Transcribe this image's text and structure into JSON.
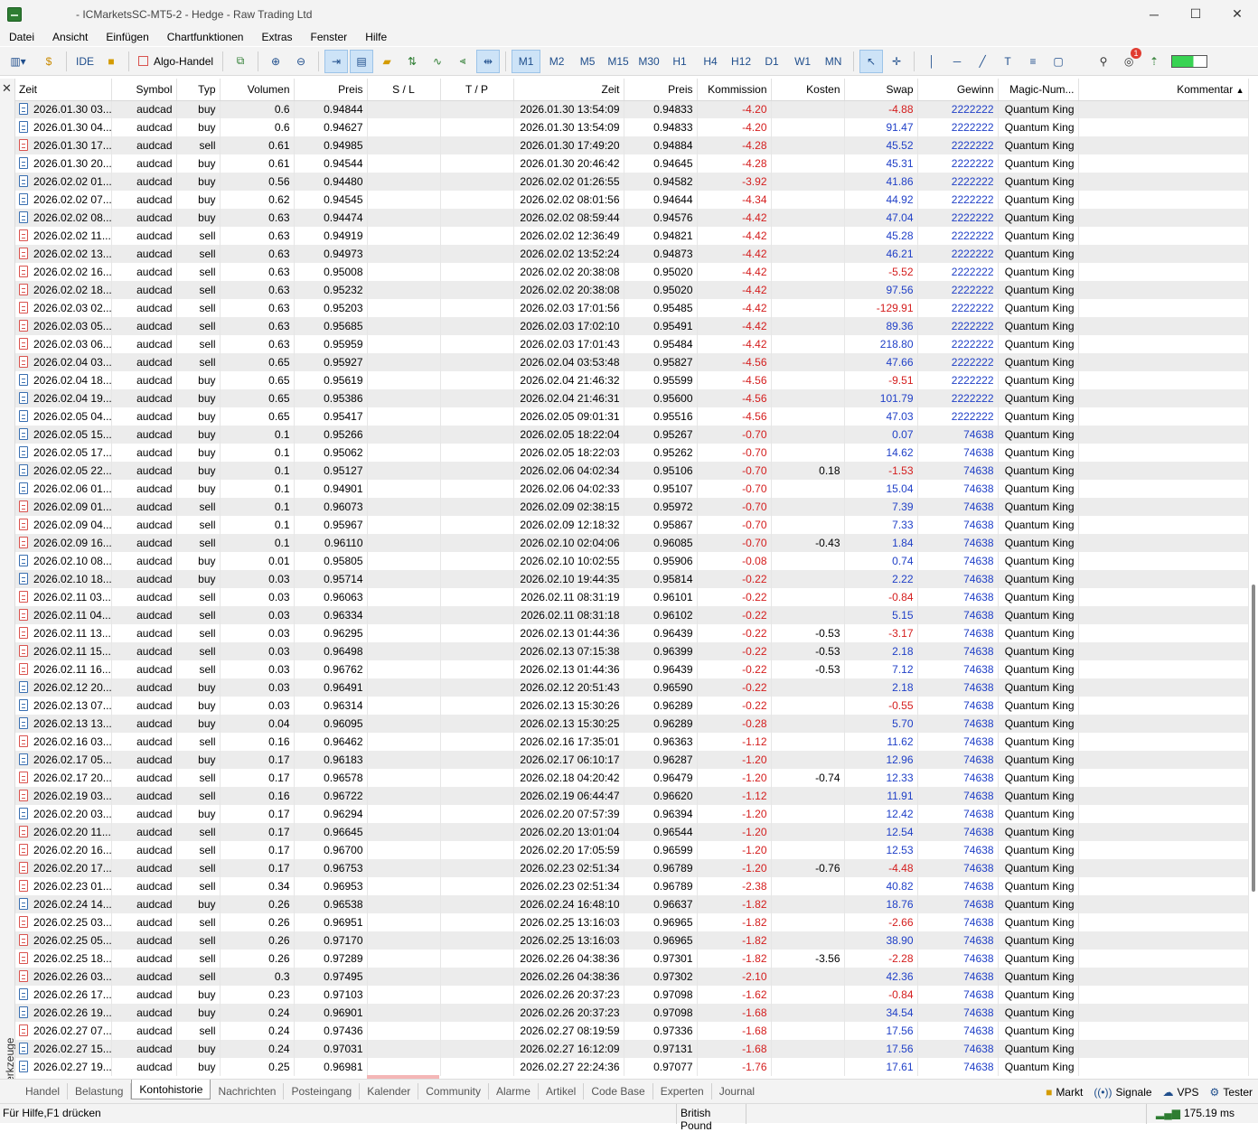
{
  "window": {
    "title": "- ICMarketsSC-MT5-2 - Hedge - Raw Trading Ltd"
  },
  "menu": [
    "Datei",
    "Ansicht",
    "Einfügen",
    "Chartfunktionen",
    "Extras",
    "Fenster",
    "Hilfe"
  ],
  "toolbar": {
    "ide_label": "IDE",
    "algo_label": "Algo-Handel",
    "timeframes": [
      "M1",
      "M2",
      "M5",
      "M15",
      "M30",
      "H1",
      "H4",
      "H12",
      "D1",
      "W1",
      "MN"
    ],
    "active_timeframe": "M1",
    "notification_count": "1"
  },
  "table": {
    "headers": [
      "Zeit",
      "Symbol",
      "Typ",
      "Volumen",
      "Preis",
      "S / L",
      "T / P",
      "Zeit",
      "Preis",
      "Kommission",
      "Kosten",
      "Swap",
      "Gewinn",
      "Magic-Num...",
      "Kommentar"
    ],
    "rows": [
      [
        "2026.01.30 03...",
        "audcad",
        "buy",
        "0.6",
        "0.94844",
        "2026.01.30 13:54:09",
        "0.94833",
        "-4.20",
        "",
        "-4.88",
        "2222222",
        "Quantum King"
      ],
      [
        "2026.01.30 04...",
        "audcad",
        "buy",
        "0.6",
        "0.94627",
        "2026.01.30 13:54:09",
        "0.94833",
        "-4.20",
        "",
        "91.47",
        "2222222",
        "Quantum King"
      ],
      [
        "2026.01.30 17...",
        "audcad",
        "sell",
        "0.61",
        "0.94985",
        "2026.01.30 17:49:20",
        "0.94884",
        "-4.28",
        "",
        "45.52",
        "2222222",
        "Quantum King"
      ],
      [
        "2026.01.30 20...",
        "audcad",
        "buy",
        "0.61",
        "0.94544",
        "2026.01.30 20:46:42",
        "0.94645",
        "-4.28",
        "",
        "45.31",
        "2222222",
        "Quantum King"
      ],
      [
        "2026.02.02 01...",
        "audcad",
        "buy",
        "0.56",
        "0.94480",
        "2026.02.02 01:26:55",
        "0.94582",
        "-3.92",
        "",
        "41.86",
        "2222222",
        "Quantum King"
      ],
      [
        "2026.02.02 07...",
        "audcad",
        "buy",
        "0.62",
        "0.94545",
        "2026.02.02 08:01:56",
        "0.94644",
        "-4.34",
        "",
        "44.92",
        "2222222",
        "Quantum King"
      ],
      [
        "2026.02.02 08...",
        "audcad",
        "buy",
        "0.63",
        "0.94474",
        "2026.02.02 08:59:44",
        "0.94576",
        "-4.42",
        "",
        "47.04",
        "2222222",
        "Quantum King"
      ],
      [
        "2026.02.02 11...",
        "audcad",
        "sell",
        "0.63",
        "0.94919",
        "2026.02.02 12:36:49",
        "0.94821",
        "-4.42",
        "",
        "45.28",
        "2222222",
        "Quantum King"
      ],
      [
        "2026.02.02 13...",
        "audcad",
        "sell",
        "0.63",
        "0.94973",
        "2026.02.02 13:52:24",
        "0.94873",
        "-4.42",
        "",
        "46.21",
        "2222222",
        "Quantum King"
      ],
      [
        "2026.02.02 16...",
        "audcad",
        "sell",
        "0.63",
        "0.95008",
        "2026.02.02 20:38:08",
        "0.95020",
        "-4.42",
        "",
        "-5.52",
        "2222222",
        "Quantum King"
      ],
      [
        "2026.02.02 18...",
        "audcad",
        "sell",
        "0.63",
        "0.95232",
        "2026.02.02 20:38:08",
        "0.95020",
        "-4.42",
        "",
        "97.56",
        "2222222",
        "Quantum King"
      ],
      [
        "2026.02.03 02...",
        "audcad",
        "sell",
        "0.63",
        "0.95203",
        "2026.02.03 17:01:56",
        "0.95485",
        "-4.42",
        "",
        "-129.91",
        "2222222",
        "Quantum King"
      ],
      [
        "2026.02.03 05...",
        "audcad",
        "sell",
        "0.63",
        "0.95685",
        "2026.02.03 17:02:10",
        "0.95491",
        "-4.42",
        "",
        "89.36",
        "2222222",
        "Quantum King"
      ],
      [
        "2026.02.03 06...",
        "audcad",
        "sell",
        "0.63",
        "0.95959",
        "2026.02.03 17:01:43",
        "0.95484",
        "-4.42",
        "",
        "218.80",
        "2222222",
        "Quantum King"
      ],
      [
        "2026.02.04 03...",
        "audcad",
        "sell",
        "0.65",
        "0.95927",
        "2026.02.04 03:53:48",
        "0.95827",
        "-4.56",
        "",
        "47.66",
        "2222222",
        "Quantum King"
      ],
      [
        "2026.02.04 18...",
        "audcad",
        "buy",
        "0.65",
        "0.95619",
        "2026.02.04 21:46:32",
        "0.95599",
        "-4.56",
        "",
        "-9.51",
        "2222222",
        "Quantum King"
      ],
      [
        "2026.02.04 19...",
        "audcad",
        "buy",
        "0.65",
        "0.95386",
        "2026.02.04 21:46:31",
        "0.95600",
        "-4.56",
        "",
        "101.79",
        "2222222",
        "Quantum King"
      ],
      [
        "2026.02.05 04...",
        "audcad",
        "buy",
        "0.65",
        "0.95417",
        "2026.02.05 09:01:31",
        "0.95516",
        "-4.56",
        "",
        "47.03",
        "2222222",
        "Quantum King"
      ],
      [
        "2026.02.05 15...",
        "audcad",
        "buy",
        "0.1",
        "0.95266",
        "2026.02.05 18:22:04",
        "0.95267",
        "-0.70",
        "",
        "0.07",
        "74638",
        "Quantum King"
      ],
      [
        "2026.02.05 17...",
        "audcad",
        "buy",
        "0.1",
        "0.95062",
        "2026.02.05 18:22:03",
        "0.95262",
        "-0.70",
        "",
        "14.62",
        "74638",
        "Quantum King"
      ],
      [
        "2026.02.05 22...",
        "audcad",
        "buy",
        "0.1",
        "0.95127",
        "2026.02.06 04:02:34",
        "0.95106",
        "-0.70",
        "0.18",
        "-1.53",
        "74638",
        "Quantum King"
      ],
      [
        "2026.02.06 01...",
        "audcad",
        "buy",
        "0.1",
        "0.94901",
        "2026.02.06 04:02:33",
        "0.95107",
        "-0.70",
        "",
        "15.04",
        "74638",
        "Quantum King"
      ],
      [
        "2026.02.09 01...",
        "audcad",
        "sell",
        "0.1",
        "0.96073",
        "2026.02.09 02:38:15",
        "0.95972",
        "-0.70",
        "",
        "7.39",
        "74638",
        "Quantum King"
      ],
      [
        "2026.02.09 04...",
        "audcad",
        "sell",
        "0.1",
        "0.95967",
        "2026.02.09 12:18:32",
        "0.95867",
        "-0.70",
        "",
        "7.33",
        "74638",
        "Quantum King"
      ],
      [
        "2026.02.09 16...",
        "audcad",
        "sell",
        "0.1",
        "0.96110",
        "2026.02.10 02:04:06",
        "0.96085",
        "-0.70",
        "-0.43",
        "1.84",
        "74638",
        "Quantum King"
      ],
      [
        "2026.02.10 08...",
        "audcad",
        "buy",
        "0.01",
        "0.95805",
        "2026.02.10 10:02:55",
        "0.95906",
        "-0.08",
        "",
        "0.74",
        "74638",
        "Quantum King"
      ],
      [
        "2026.02.10 18...",
        "audcad",
        "buy",
        "0.03",
        "0.95714",
        "2026.02.10 19:44:35",
        "0.95814",
        "-0.22",
        "",
        "2.22",
        "74638",
        "Quantum King"
      ],
      [
        "2026.02.11 03...",
        "audcad",
        "sell",
        "0.03",
        "0.96063",
        "2026.02.11 08:31:19",
        "0.96101",
        "-0.22",
        "",
        "-0.84",
        "74638",
        "Quantum King"
      ],
      [
        "2026.02.11 04...",
        "audcad",
        "sell",
        "0.03",
        "0.96334",
        "2026.02.11 08:31:18",
        "0.96102",
        "-0.22",
        "",
        "5.15",
        "74638",
        "Quantum King"
      ],
      [
        "2026.02.11 13...",
        "audcad",
        "sell",
        "0.03",
        "0.96295",
        "2026.02.13 01:44:36",
        "0.96439",
        "-0.22",
        "-0.53",
        "-3.17",
        "74638",
        "Quantum King"
      ],
      [
        "2026.02.11 15...",
        "audcad",
        "sell",
        "0.03",
        "0.96498",
        "2026.02.13 07:15:38",
        "0.96399",
        "-0.22",
        "-0.53",
        "2.18",
        "74638",
        "Quantum King"
      ],
      [
        "2026.02.11 16...",
        "audcad",
        "sell",
        "0.03",
        "0.96762",
        "2026.02.13 01:44:36",
        "0.96439",
        "-0.22",
        "-0.53",
        "7.12",
        "74638",
        "Quantum King"
      ],
      [
        "2026.02.12 20...",
        "audcad",
        "buy",
        "0.03",
        "0.96491",
        "2026.02.12 20:51:43",
        "0.96590",
        "-0.22",
        "",
        "2.18",
        "74638",
        "Quantum King"
      ],
      [
        "2026.02.13 07...",
        "audcad",
        "buy",
        "0.03",
        "0.96314",
        "2026.02.13 15:30:26",
        "0.96289",
        "-0.22",
        "",
        "-0.55",
        "74638",
        "Quantum King"
      ],
      [
        "2026.02.13 13...",
        "audcad",
        "buy",
        "0.04",
        "0.96095",
        "2026.02.13 15:30:25",
        "0.96289",
        "-0.28",
        "",
        "5.70",
        "74638",
        "Quantum King"
      ],
      [
        "2026.02.16 03...",
        "audcad",
        "sell",
        "0.16",
        "0.96462",
        "2026.02.16 17:35:01",
        "0.96363",
        "-1.12",
        "",
        "11.62",
        "74638",
        "Quantum King"
      ],
      [
        "2026.02.17 05...",
        "audcad",
        "buy",
        "0.17",
        "0.96183",
        "2026.02.17 06:10:17",
        "0.96287",
        "-1.20",
        "",
        "12.96",
        "74638",
        "Quantum King"
      ],
      [
        "2026.02.17 20...",
        "audcad",
        "sell",
        "0.17",
        "0.96578",
        "2026.02.18 04:20:42",
        "0.96479",
        "-1.20",
        "-0.74",
        "12.33",
        "74638",
        "Quantum King"
      ],
      [
        "2026.02.19 03...",
        "audcad",
        "sell",
        "0.16",
        "0.96722",
        "2026.02.19 06:44:47",
        "0.96620",
        "-1.12",
        "",
        "11.91",
        "74638",
        "Quantum King"
      ],
      [
        "2026.02.20 03...",
        "audcad",
        "buy",
        "0.17",
        "0.96294",
        "2026.02.20 07:57:39",
        "0.96394",
        "-1.20",
        "",
        "12.42",
        "74638",
        "Quantum King"
      ],
      [
        "2026.02.20 11...",
        "audcad",
        "sell",
        "0.17",
        "0.96645",
        "2026.02.20 13:01:04",
        "0.96544",
        "-1.20",
        "",
        "12.54",
        "74638",
        "Quantum King"
      ],
      [
        "2026.02.20 16...",
        "audcad",
        "sell",
        "0.17",
        "0.96700",
        "2026.02.20 17:05:59",
        "0.96599",
        "-1.20",
        "",
        "12.53",
        "74638",
        "Quantum King"
      ],
      [
        "2026.02.20 17...",
        "audcad",
        "sell",
        "0.17",
        "0.96753",
        "2026.02.23 02:51:34",
        "0.96789",
        "-1.20",
        "-0.76",
        "-4.48",
        "74638",
        "Quantum King"
      ],
      [
        "2026.02.23 01...",
        "audcad",
        "sell",
        "0.34",
        "0.96953",
        "2026.02.23 02:51:34",
        "0.96789",
        "-2.38",
        "",
        "40.82",
        "74638",
        "Quantum King"
      ],
      [
        "2026.02.24 14...",
        "audcad",
        "buy",
        "0.26",
        "0.96538",
        "2026.02.24 16:48:10",
        "0.96637",
        "-1.82",
        "",
        "18.76",
        "74638",
        "Quantum King"
      ],
      [
        "2026.02.25 03...",
        "audcad",
        "sell",
        "0.26",
        "0.96951",
        "2026.02.25 13:16:03",
        "0.96965",
        "-1.82",
        "",
        "-2.66",
        "74638",
        "Quantum King"
      ],
      [
        "2026.02.25 05...",
        "audcad",
        "sell",
        "0.26",
        "0.97170",
        "2026.02.25 13:16:03",
        "0.96965",
        "-1.82",
        "",
        "38.90",
        "74638",
        "Quantum King"
      ],
      [
        "2026.02.25 18...",
        "audcad",
        "sell",
        "0.26",
        "0.97289",
        "2026.02.26 04:38:36",
        "0.97301",
        "-1.82",
        "-3.56",
        "-2.28",
        "74638",
        "Quantum King"
      ],
      [
        "2026.02.26 03...",
        "audcad",
        "sell",
        "0.3",
        "0.97495",
        "2026.02.26 04:38:36",
        "0.97302",
        "-2.10",
        "",
        "42.36",
        "74638",
        "Quantum King"
      ],
      [
        "2026.02.26 17...",
        "audcad",
        "buy",
        "0.23",
        "0.97103",
        "2026.02.26 20:37:23",
        "0.97098",
        "-1.62",
        "",
        "-0.84",
        "74638",
        "Quantum King"
      ],
      [
        "2026.02.26 19...",
        "audcad",
        "buy",
        "0.24",
        "0.96901",
        "2026.02.26 20:37:23",
        "0.97098",
        "-1.68",
        "",
        "34.54",
        "74638",
        "Quantum King"
      ],
      [
        "2026.02.27 07...",
        "audcad",
        "sell",
        "0.24",
        "0.97436",
        "2026.02.27 08:19:59",
        "0.97336",
        "-1.68",
        "",
        "17.56",
        "74638",
        "Quantum King"
      ],
      [
        "2026.02.27 15...",
        "audcad",
        "buy",
        "0.24",
        "0.97031",
        "2026.02.27 16:12:09",
        "0.97131",
        "-1.68",
        "",
        "17.56",
        "74638",
        "Quantum King"
      ],
      [
        "2026.02.27 19...",
        "audcad",
        "buy",
        "0.25",
        "0.96981",
        "2026.02.27 22:24:36",
        "0.97077",
        "-1.76",
        "",
        "17.61",
        "74638",
        "Quantum King"
      ]
    ]
  },
  "left_panel_label": "Werkzeuge",
  "tabs": [
    "Handel",
    "Belastung",
    "Kontohistorie",
    "Nachrichten",
    "Posteingang",
    "Kalender",
    "Community",
    "Alarme",
    "Artikel",
    "Code Base",
    "Experten",
    "Journal"
  ],
  "active_tab": "Kontohistorie",
  "right_tabs": [
    "Markt",
    "Signale",
    "VPS",
    "Tester"
  ],
  "status": {
    "help": "Für Hilfe,F1 drücken",
    "currency": "British Pound",
    "ping": "175.19 ms"
  },
  "colors": {
    "positive": "#1f3fc7",
    "negative": "#d41c1c",
    "active_toolbar": "#cde3f7"
  }
}
